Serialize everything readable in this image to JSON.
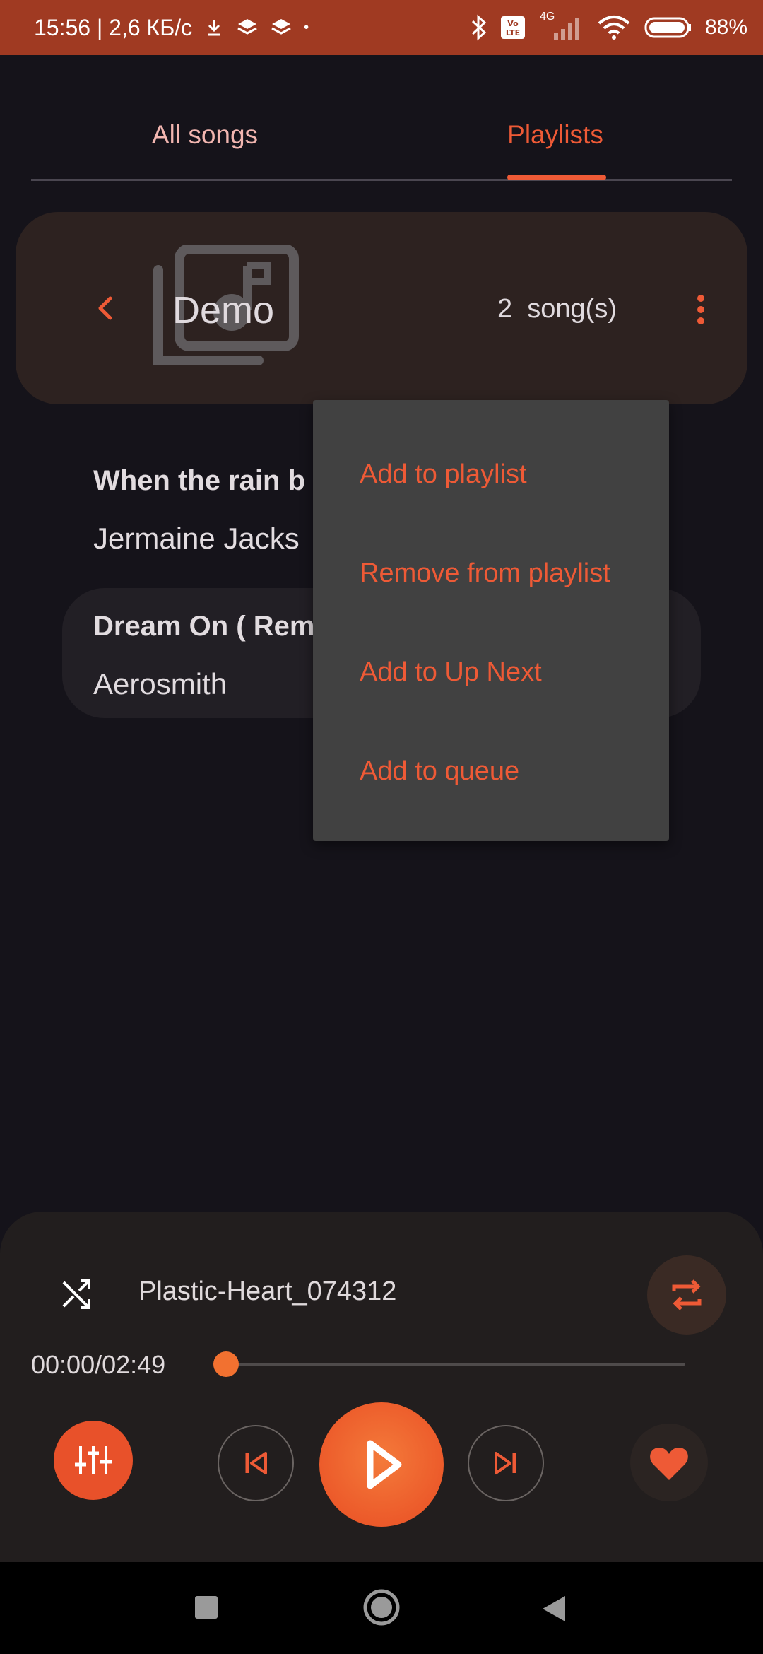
{
  "status_bar": {
    "time_speed": "15:56 | 2,6 КБ/с",
    "dot": "•",
    "network": "4G",
    "battery_percent": "88%"
  },
  "tabs": [
    {
      "label": "All songs",
      "active": false
    },
    {
      "label": "Playlists",
      "active": true
    }
  ],
  "playlist": {
    "name": "Demo",
    "count": "2",
    "count_label": "song(s)"
  },
  "songs": [
    {
      "title": "When the rain b",
      "artist": "Jermaine Jacks"
    },
    {
      "title": "Dream On ( Rem",
      "artist": "Aerosmith"
    }
  ],
  "menu": {
    "items": [
      {
        "label": "Add to playlist"
      },
      {
        "label": "Remove from playlist"
      },
      {
        "label": "Add to Up Next"
      },
      {
        "label": "Add to queue"
      }
    ]
  },
  "player": {
    "track_name": "Plastic-Heart_074312",
    "time": "00:00/02:49",
    "progress": 0
  },
  "colors": {
    "accent": "#ee5a36",
    "status_bar": "#a03a22",
    "background": "#15131a",
    "menu_bg": "#414141"
  },
  "icons": [
    "shuffle-icon",
    "repeat-icon",
    "equalizer-icon",
    "previous-icon",
    "play-icon",
    "next-icon",
    "heart-icon",
    "more-vert-icon",
    "back-chevron-icon",
    "playlist-cover-icon"
  ]
}
